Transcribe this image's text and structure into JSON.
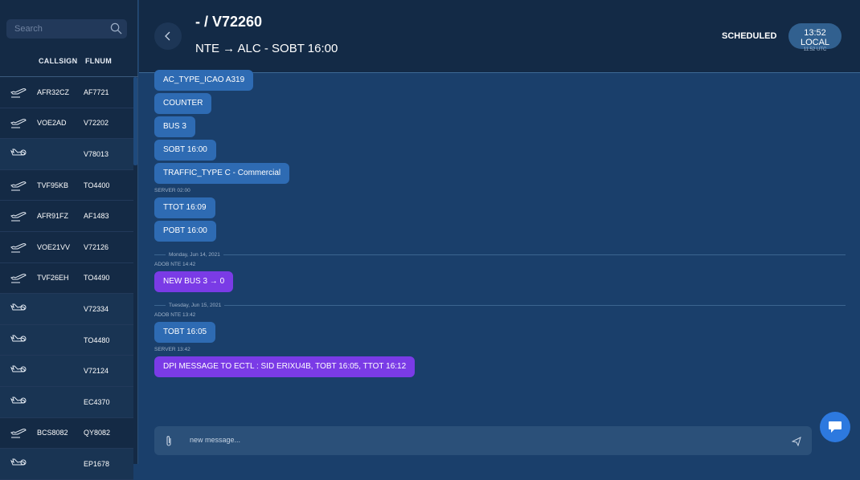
{
  "sidebar": {
    "search_placeholder": "Search",
    "columns": [
      "CALLSIGN",
      "FLNUM"
    ],
    "flights": [
      {
        "type": "departure",
        "callsign": "AFR32CZ",
        "flnum": "AF7721"
      },
      {
        "type": "departure",
        "callsign": "VOE2AD",
        "flnum": "V72202"
      },
      {
        "type": "arrival",
        "callsign": "",
        "flnum": "V78013"
      },
      {
        "type": "departure",
        "callsign": "TVF95KB",
        "flnum": "TO4400"
      },
      {
        "type": "departure",
        "callsign": "AFR91FZ",
        "flnum": "AF1483"
      },
      {
        "type": "departure",
        "callsign": "VOE21VV",
        "flnum": "V72126"
      },
      {
        "type": "departure",
        "callsign": "TVF26EH",
        "flnum": "TO4490"
      },
      {
        "type": "arrival",
        "callsign": "",
        "flnum": "V72334"
      },
      {
        "type": "arrival",
        "callsign": "",
        "flnum": "TO4480"
      },
      {
        "type": "arrival",
        "callsign": "",
        "flnum": "V72124"
      },
      {
        "type": "arrival",
        "callsign": "",
        "flnum": "EC4370"
      },
      {
        "type": "departure",
        "callsign": "BCS8082",
        "flnum": "QY8082"
      },
      {
        "type": "arrival",
        "callsign": "",
        "flnum": "EP1678"
      }
    ]
  },
  "header": {
    "title": "- / V72260",
    "route": "NTE → ALC - SOBT 16:00",
    "status": "SCHEDULED",
    "local_time": "13:52 LOCAL",
    "utc_time": "11:52 UTC"
  },
  "chat": {
    "items": [
      {
        "kind": "bubble",
        "text": "AC_TYPE_ICAO A319"
      },
      {
        "kind": "bubble",
        "text": "COUNTER"
      },
      {
        "kind": "bubble",
        "text": "BUS 3"
      },
      {
        "kind": "bubble",
        "text": "SOBT 16:00"
      },
      {
        "kind": "bubble",
        "text": "TRAFFIC_TYPE C - Commercial"
      },
      {
        "kind": "meta",
        "text": "SERVER 02:00"
      },
      {
        "kind": "bubble",
        "text": "TTOT 16:09"
      },
      {
        "kind": "bubble",
        "text": "POBT 16:00"
      },
      {
        "kind": "sep",
        "text": "Monday, Jun 14, 2021"
      },
      {
        "kind": "meta",
        "text": "ADOB NTE 14:42"
      },
      {
        "kind": "bubble",
        "purple": true,
        "text": "NEW BUS 3 → 0"
      },
      {
        "kind": "sep",
        "text": "Tuesday, Jun 15, 2021"
      },
      {
        "kind": "meta",
        "text": "ADOB NTE 13:42"
      },
      {
        "kind": "bubble",
        "text": "TOBT 16:05"
      },
      {
        "kind": "meta",
        "text": "SERVER 13:42"
      },
      {
        "kind": "bubble",
        "purple": true,
        "text": "DPI MESSAGE TO ECTL : SID ERIXU4B, TOBT 16:05, TTOT 16:12"
      }
    ]
  },
  "composer": {
    "placeholder": "new message..."
  },
  "colors": {
    "bubble": "#2e6bb3",
    "purple": "#7a3be6",
    "fab": "#2d79df"
  }
}
